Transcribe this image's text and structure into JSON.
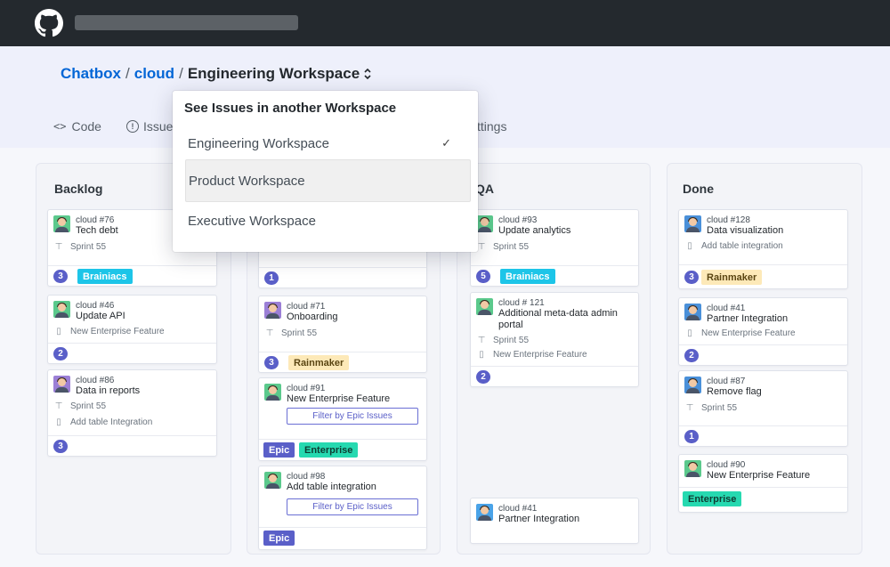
{
  "breadcrumb": {
    "owner": "Chatbox",
    "repo": "cloud",
    "workspace": "Engineering Workspace"
  },
  "tabs": {
    "code": "Code",
    "issues": "Issue",
    "settings": "ttings"
  },
  "dropdown": {
    "title": "See Issues in another Workspace",
    "items": [
      "Engineering Workspace",
      "Product Workspace",
      "Executive Workspace"
    ],
    "selected_mark": "✓"
  },
  "columns": {
    "backlog": "Backlog",
    "qa": "QA",
    "done": "Done"
  },
  "cards": {
    "b1": {
      "id": "cloud #76",
      "title": "Tech debt",
      "sprint": "Sprint 55",
      "count": "3",
      "label": "Brainiacs"
    },
    "b2": {
      "id": "cloud #46",
      "title": "Update API",
      "epic": "New Enterprise Feature",
      "count": "2"
    },
    "b3": {
      "id": "cloud #86",
      "title": "Data in reports",
      "sprint": "Sprint 55",
      "epic": "Add table Integration",
      "count": "3"
    },
    "p0": {
      "count": "1"
    },
    "p1": {
      "id": "cloud #71",
      "title": "Onboarding",
      "sprint": "Sprint 55",
      "count": "3",
      "label": "Rainmaker"
    },
    "p2": {
      "id": "cloud #91",
      "title": "New Enterprise Feature",
      "filter": "Filter by Epic Issues",
      "label1": "Epic",
      "label2": "Enterprise"
    },
    "p3": {
      "id": "cloud #98",
      "title": "Add table integration",
      "filter": "Filter by Epic Issues",
      "label1": "Epic"
    },
    "q1": {
      "id": "cloud #93",
      "title": "Update analytics",
      "sprint": "Sprint 55",
      "count": "5",
      "label": "Brainiacs"
    },
    "q2": {
      "id": "cloud # 121",
      "title": "Additional meta-data admin portal",
      "sprint": "Sprint 55",
      "epic": "New Enterprise Feature",
      "count": "2"
    },
    "q3": {
      "id": "cloud #41",
      "title": "Partner Integration"
    },
    "d1": {
      "id": "cloud #128",
      "title": "Data visualization",
      "epic": "Add table integration",
      "count": "3",
      "label": "Rainmaker"
    },
    "d2": {
      "id": "cloud #41",
      "title": "Partner Integration",
      "epic": "New Enterprise Feature",
      "count": "2"
    },
    "d3": {
      "id": "cloud #87",
      "title": "Remove flag",
      "sprint": "Sprint 55",
      "count": "1"
    },
    "d4": {
      "id": "cloud #90",
      "title": "New Enterprise Feature",
      "label": "Enterprise"
    }
  },
  "colors": {
    "topbar": "#24292e",
    "link": "#0366d6",
    "count_badge": "#5a5fc8",
    "brainiacs": "#1dc5e8",
    "rainmaker": "#fde9b8",
    "epic": "#5a5fc8",
    "enterprise": "#26d9b0"
  },
  "icons": [
    "github-logo-icon",
    "code-icon",
    "issues-icon",
    "chevron-updown-icon",
    "sprint-icon",
    "epic-icon",
    "check-icon"
  ]
}
